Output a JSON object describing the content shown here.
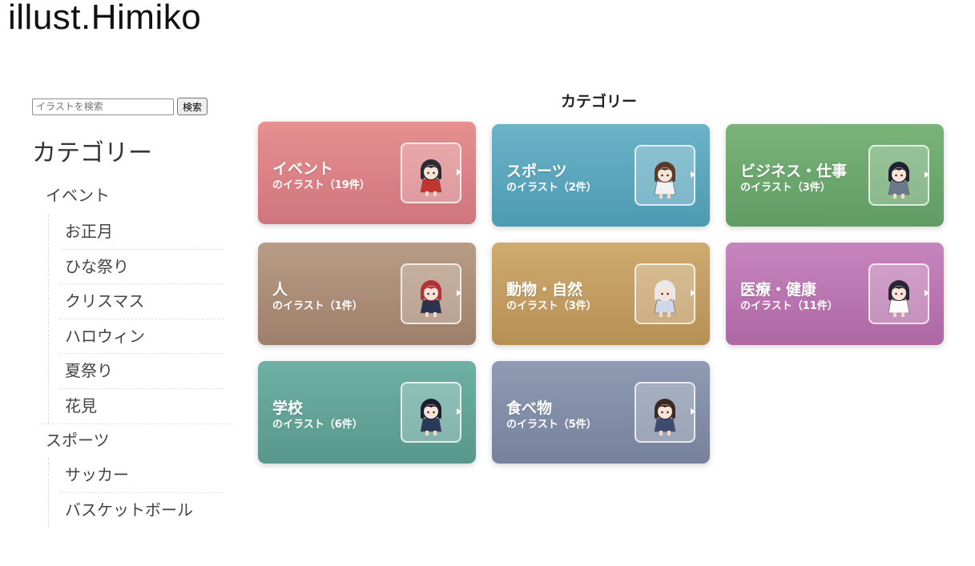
{
  "site": {
    "title": "illust.Himiko"
  },
  "search": {
    "placeholder": "イラストを検索",
    "button_label": "検索"
  },
  "sidebar": {
    "heading": "カテゴリー",
    "categories": [
      {
        "label": "イベント",
        "items": [
          "お正月",
          "ひな祭り",
          "クリスマス",
          "ハロウィン",
          "夏祭り",
          "花見"
        ]
      },
      {
        "label": "スポーツ",
        "items": [
          "サッカー",
          "バスケットボール"
        ]
      }
    ]
  },
  "main": {
    "heading": "カテゴリー",
    "cards": [
      {
        "title": "イベント",
        "subtitle": "のイラスト（19件）",
        "color_top": "#e6908f",
        "color_bottom": "#cf757d",
        "icon": "kimono-character-icon",
        "hair": "#2b2b33",
        "outfit": "#c0352f"
      },
      {
        "title": "スポーツ",
        "subtitle": "のイラスト（2件）",
        "color_top": "#6bb3c8",
        "color_bottom": "#4c9ab3",
        "icon": "sports-character-icon",
        "hair": "#5a3a2a",
        "outfit": "#f2f2f2"
      },
      {
        "title": "ビジネス・仕事",
        "subtitle": "のイラスト（3件）",
        "color_top": "#7ab37a",
        "color_bottom": "#5f9c63",
        "icon": "office-worker-icon",
        "hair": "#1f2233",
        "outfit": "#6a7a8a"
      },
      {
        "title": "人",
        "subtitle": "のイラスト（1件）",
        "color_top": "#b89c85",
        "color_bottom": "#9e7f6b",
        "icon": "student-character-icon",
        "hair": "#b0333a",
        "outfit": "#2a3350"
      },
      {
        "title": "動物・自然",
        "subtitle": "のイラスト（3件）",
        "color_top": "#cfab70",
        "color_bottom": "#b68f55",
        "icon": "animal-character-icon",
        "hair": "#e8e8ee",
        "outfit": "#cfd8e8"
      },
      {
        "title": "医療・健康",
        "subtitle": "のイラスト（11件）",
        "color_top": "#c785bd",
        "color_bottom": "#ad67a3",
        "icon": "nurse-character-icon",
        "hair": "#252533",
        "outfit": "#ffffff"
      },
      {
        "title": "学校",
        "subtitle": "のイラスト（6件）",
        "color_top": "#6fb0a5",
        "color_bottom": "#57978c",
        "icon": "school-character-icon",
        "hair": "#1c1f2e",
        "outfit": "#2c3a5a"
      },
      {
        "title": "食べ物",
        "subtitle": "のイラスト（5件）",
        "color_top": "#8f9ab3",
        "color_bottom": "#76829c",
        "icon": "food-character-icon",
        "hair": "#3a2a22",
        "outfit": "#3d4a72"
      }
    ]
  }
}
